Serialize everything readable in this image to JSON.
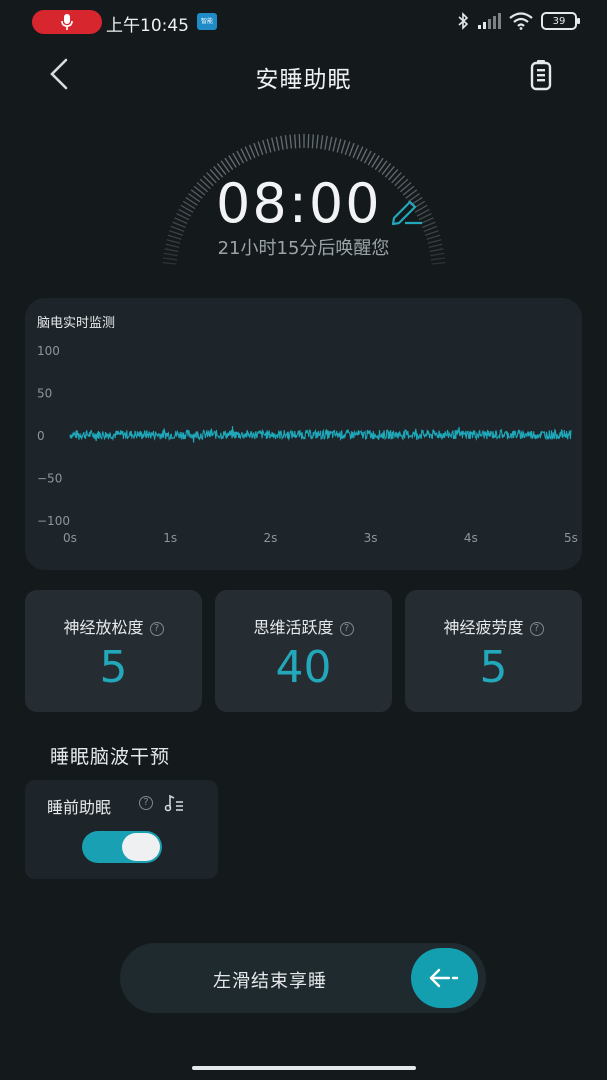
{
  "status_bar": {
    "time": "上午10:45",
    "app_badge": "智能",
    "battery": "39"
  },
  "header": {
    "title": "安睡助眠"
  },
  "alarm": {
    "time": "08:00",
    "hint": "21小时15分后唤醒您"
  },
  "eeg": {
    "title": "脑电实时监测",
    "chart_data": {
      "type": "line",
      "x_ticks": [
        "0s",
        "1s",
        "2s",
        "3s",
        "4s",
        "5s"
      ],
      "y_ticks": [
        "100",
        "50",
        "0",
        "−50",
        "−100"
      ],
      "ylim": [
        -100,
        100
      ],
      "xlim": [
        0,
        5
      ],
      "grid": false,
      "series": [
        {
          "values_description_range": [
            -5,
            6
          ],
          "color": "#1ea8ba"
        }
      ]
    }
  },
  "metrics": [
    {
      "label": "神经放松度",
      "value": "5"
    },
    {
      "label": "思维活跃度",
      "value": "40"
    },
    {
      "label": "神经疲劳度",
      "value": "5"
    }
  ],
  "section": {
    "title": "睡眠脑波干预"
  },
  "pre_sleep": {
    "label": "睡前助眠",
    "enabled": true
  },
  "slider": {
    "label": "左滑结束享睡"
  },
  "colors": {
    "accent": "#1aa0b3",
    "background": "#14191c",
    "card": "#252d33"
  }
}
